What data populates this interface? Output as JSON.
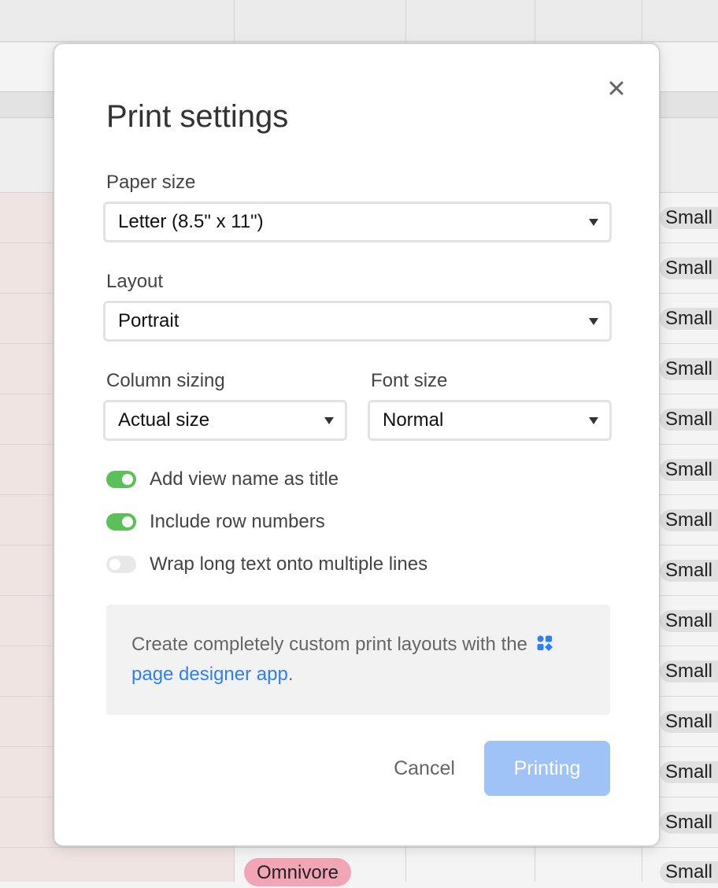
{
  "modal": {
    "title": "Print settings",
    "close_icon": "close-icon"
  },
  "fields": {
    "paper_size": {
      "label": "Paper size",
      "value": "Letter (8.5\" x 11\")"
    },
    "layout": {
      "label": "Layout",
      "value": "Portrait"
    },
    "column_sizing": {
      "label": "Column sizing",
      "value": "Actual size"
    },
    "font_size": {
      "label": "Font size",
      "value": "Normal"
    }
  },
  "toggles": [
    {
      "label": "Add view name as title",
      "on": true
    },
    {
      "label": "Include row numbers",
      "on": true
    },
    {
      "label": "Wrap long text onto multiple lines",
      "on": false
    }
  ],
  "info": {
    "text_before": "Create completely custom print layouts with the",
    "link_text": "page designer app",
    "text_after": ".",
    "app_icon": "page-designer-app-icon"
  },
  "buttons": {
    "cancel": "Cancel",
    "print": "Printing"
  },
  "background": {
    "pill_label": "Small",
    "tag_label": "Omnivore"
  },
  "colors": {
    "toggle_on": "#5bc05a",
    "link": "#2d7ff9",
    "print_button": "#9fc2f7",
    "tag_pink": "#f2a6b5"
  }
}
